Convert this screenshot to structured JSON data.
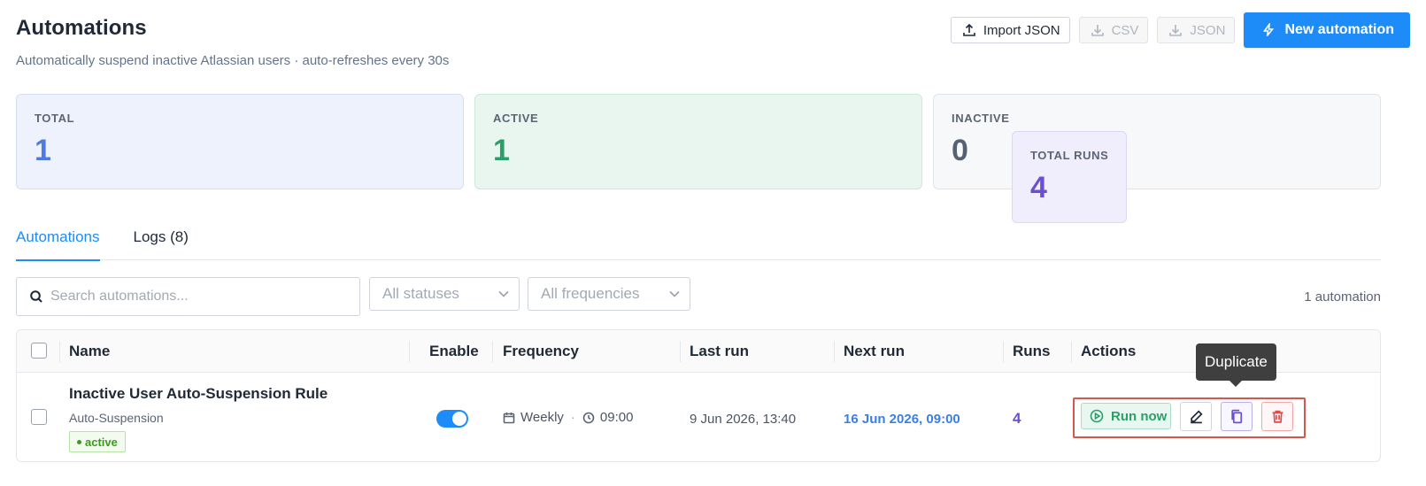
{
  "header": {
    "title": "Automations",
    "subtitle": "Automatically suspend inactive Atlassian users · auto-refreshes every 30s",
    "import_label": "Import JSON",
    "csv_label": "CSV",
    "json_label": "JSON",
    "new_label": "New automation"
  },
  "stats": [
    {
      "label": "TOTAL",
      "value": "1"
    },
    {
      "label": "ACTIVE",
      "value": "1"
    },
    {
      "label": "INACTIVE",
      "value": "0"
    },
    {
      "label": "TOTAL RUNS",
      "value": "4"
    }
  ],
  "tabs": [
    {
      "label": "Automations",
      "active": true
    },
    {
      "label": "Logs (8)",
      "active": false
    }
  ],
  "toolbar": {
    "search_placeholder": "Search automations...",
    "status_select": "All statuses",
    "frequency_select": "All frequencies",
    "count": "1 automation"
  },
  "table": {
    "columns": [
      "Name",
      "Enable",
      "Frequency",
      "Last run",
      "Next run",
      "Runs",
      "Actions"
    ],
    "rows": [
      {
        "name": "Inactive User Auto-Suspension Rule",
        "type": "Auto-Suspension",
        "status": "active",
        "enabled": true,
        "frequency": "Weekly",
        "time": "09:00",
        "last_run": "9 Jun 2026, 13:40",
        "next_run": "16 Jun 2026, 09:00",
        "runs": "4",
        "run_now_label": "Run now"
      }
    ]
  },
  "tooltip": "Duplicate",
  "colors": {
    "primary": "#1d8cf8",
    "success": "#2c9f68",
    "purple": "#6a4fd0",
    "danger": "#e24a4a",
    "highlight_border": "#d4574e"
  }
}
